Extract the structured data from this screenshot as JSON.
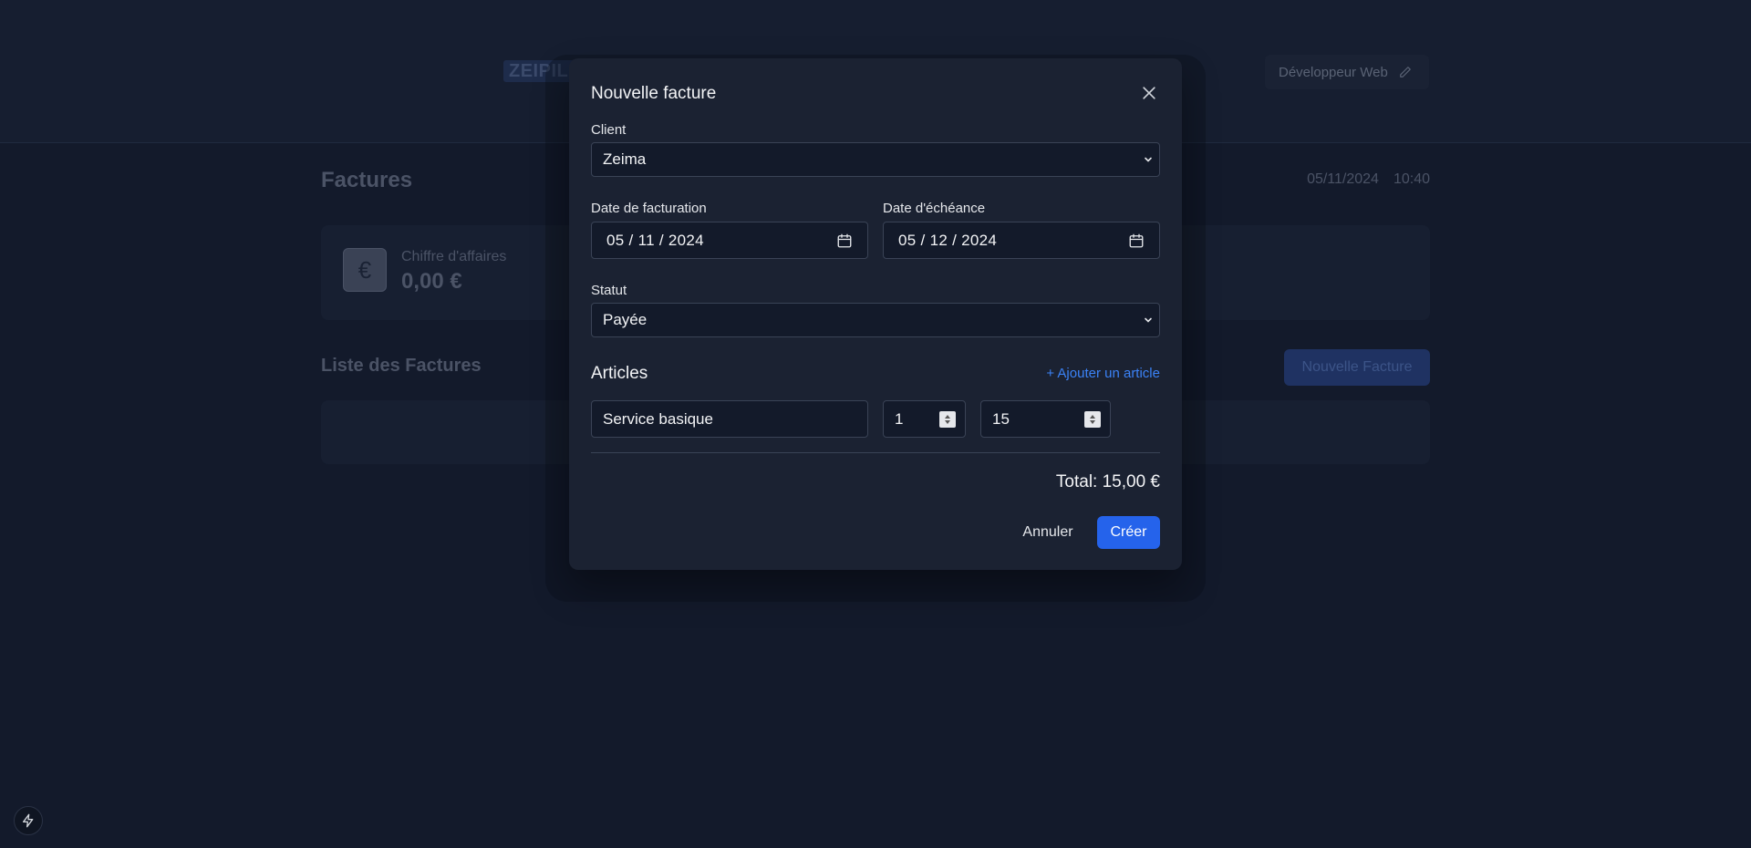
{
  "background": {
    "logo_text": "ZEIPIL",
    "profile_label": "Développeur Web",
    "page_title": "Factures",
    "date": "05/11/2024",
    "time": "10:40",
    "stat": {
      "label": "Chiffre d'affaires",
      "value": "0,00 €",
      "icon_glyph": "€"
    },
    "list_title": "Liste des Factures",
    "new_invoice_label": "Nouvelle Facture"
  },
  "modal": {
    "title": "Nouvelle facture",
    "client": {
      "label": "Client",
      "value": "Zeima"
    },
    "invoice_date": {
      "label": "Date de facturation",
      "value": "05 / 11 / 2024"
    },
    "due_date": {
      "label": "Date d'échéance",
      "value": "05 / 12 / 2024"
    },
    "status": {
      "label": "Statut",
      "value": "Payée"
    },
    "articles": {
      "title": "Articles",
      "add_label": "+ Ajouter un article",
      "items": [
        {
          "description": "Service basique",
          "quantity": "1",
          "price": "15"
        }
      ]
    },
    "total": "Total: 15,00 €",
    "cancel_label": "Annuler",
    "create_label": "Créer"
  },
  "colors": {
    "accent": "#2563eb",
    "link": "#3b82f6",
    "modal_bg": "#1b2232",
    "page_bg": "#131a2b"
  }
}
